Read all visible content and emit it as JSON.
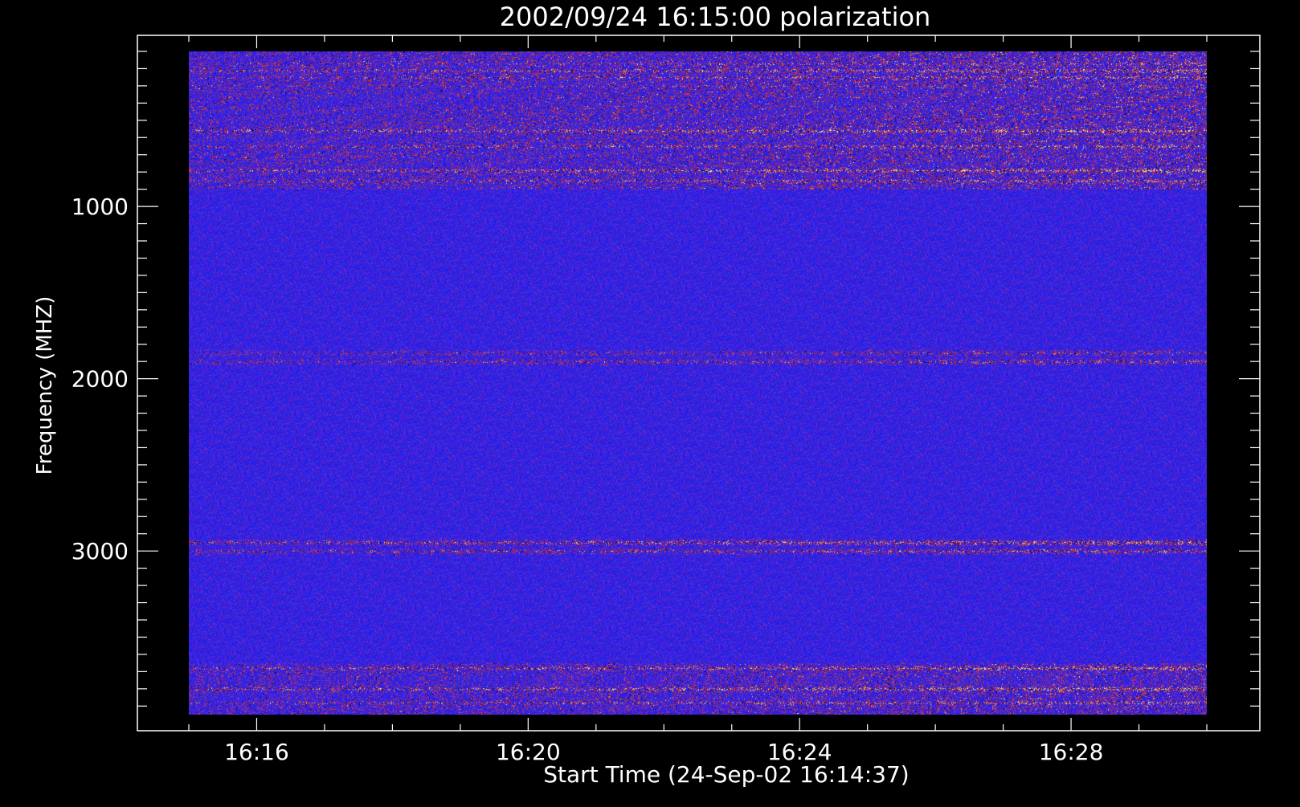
{
  "chart_data": {
    "type": "heatmap",
    "title": "2002/09/24 16:15:00 polarization",
    "xlabel": "Start Time (24-Sep-02 16:14:37)",
    "ylabel": "Frequency (MHZ)",
    "x_tick_labels": [
      "16:16",
      "16:20",
      "16:24",
      "16:28"
    ],
    "x_tick_values_min": [
      16,
      20,
      24,
      28
    ],
    "x_range_min": [
      15.0,
      30.0
    ],
    "y_tick_labels": [
      "1000",
      "2000",
      "3000"
    ],
    "y_tick_values": [
      1000,
      2000,
      3000
    ],
    "y_range": [
      4000,
      100
    ],
    "y_data_range": [
      3950,
      100
    ],
    "y_inverted": true,
    "colors": {
      "background": "#000000",
      "base": "#1a1adc",
      "hot_low": "#c81e1e",
      "hot_mid": "#ff6a2a",
      "hot_high": "#ffff7a"
    },
    "bands_mhz": [
      {
        "freq": 170,
        "strength": 0.7
      },
      {
        "freq": 210,
        "strength": 0.9
      },
      {
        "freq": 250,
        "strength": 0.8
      },
      {
        "freq": 300,
        "strength": 0.6
      },
      {
        "freq": 560,
        "strength": 1.0
      },
      {
        "freq": 650,
        "strength": 0.8
      },
      {
        "freq": 790,
        "strength": 1.0
      },
      {
        "freq": 850,
        "strength": 0.8
      },
      {
        "freq": 1850,
        "strength": 0.5
      },
      {
        "freq": 1900,
        "strength": 0.6
      },
      {
        "freq": 2950,
        "strength": 0.9
      },
      {
        "freq": 3000,
        "strength": 0.7
      },
      {
        "freq": 3680,
        "strength": 0.9
      },
      {
        "freq": 3800,
        "strength": 1.0
      },
      {
        "freq": 3880,
        "strength": 0.8
      }
    ]
  }
}
